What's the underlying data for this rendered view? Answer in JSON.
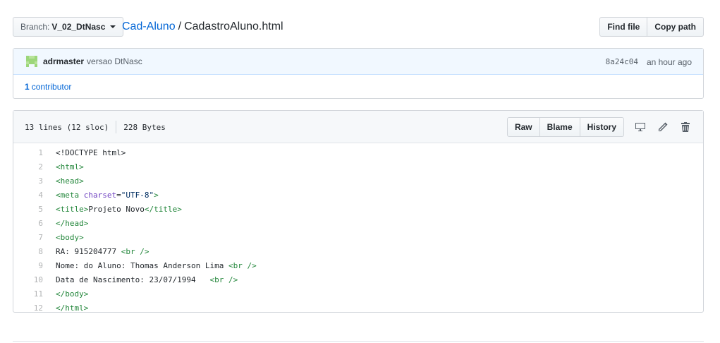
{
  "branch": {
    "label": "Branch:",
    "value": "V_02_DtNasc"
  },
  "breadcrumb": {
    "repo": "Cad-Aluno",
    "separator": "/",
    "file": "CadastroAluno.html"
  },
  "file_nav": {
    "find_file": "Find file",
    "copy_path": "Copy path"
  },
  "commit": {
    "author": "adrmaster",
    "message": "versao DtNasc",
    "sha": "8a24c04",
    "time": "an hour ago",
    "contributors_count": "1",
    "contributors_label": "contributor"
  },
  "file_header": {
    "lines": "13 lines (12 sloc)",
    "size": "228 Bytes",
    "raw": "Raw",
    "blame": "Blame",
    "history": "History",
    "icons": [
      "desktop-icon",
      "pencil-icon",
      "trash-icon"
    ]
  },
  "code": [
    {
      "n": "1",
      "text": "<!DOCTYPE html>"
    },
    {
      "n": "2",
      "text": "<html>"
    },
    {
      "n": "3",
      "text": "<head>"
    },
    {
      "n": "4",
      "text": "<meta charset=\"UTF-8\">"
    },
    {
      "n": "5",
      "text": "<title>Projeto Novo</title>"
    },
    {
      "n": "6",
      "text": "</head>"
    },
    {
      "n": "7",
      "text": "<body>"
    },
    {
      "n": "8",
      "text": "RA: 915204777 <br />"
    },
    {
      "n": "9",
      "text": "Nome: do Aluno: Thomas Anderson Lima <br />"
    },
    {
      "n": "10",
      "text": "Data de Nascimento: 23/07/1994   <br />"
    },
    {
      "n": "11",
      "text": "</body>"
    },
    {
      "n": "12",
      "text": "</html>"
    }
  ],
  "colors": {
    "link": "#0366d6",
    "tag": "#22863a",
    "attr": "#6f42c1",
    "string": "#032f62",
    "commit_bg": "#f1f8ff"
  }
}
